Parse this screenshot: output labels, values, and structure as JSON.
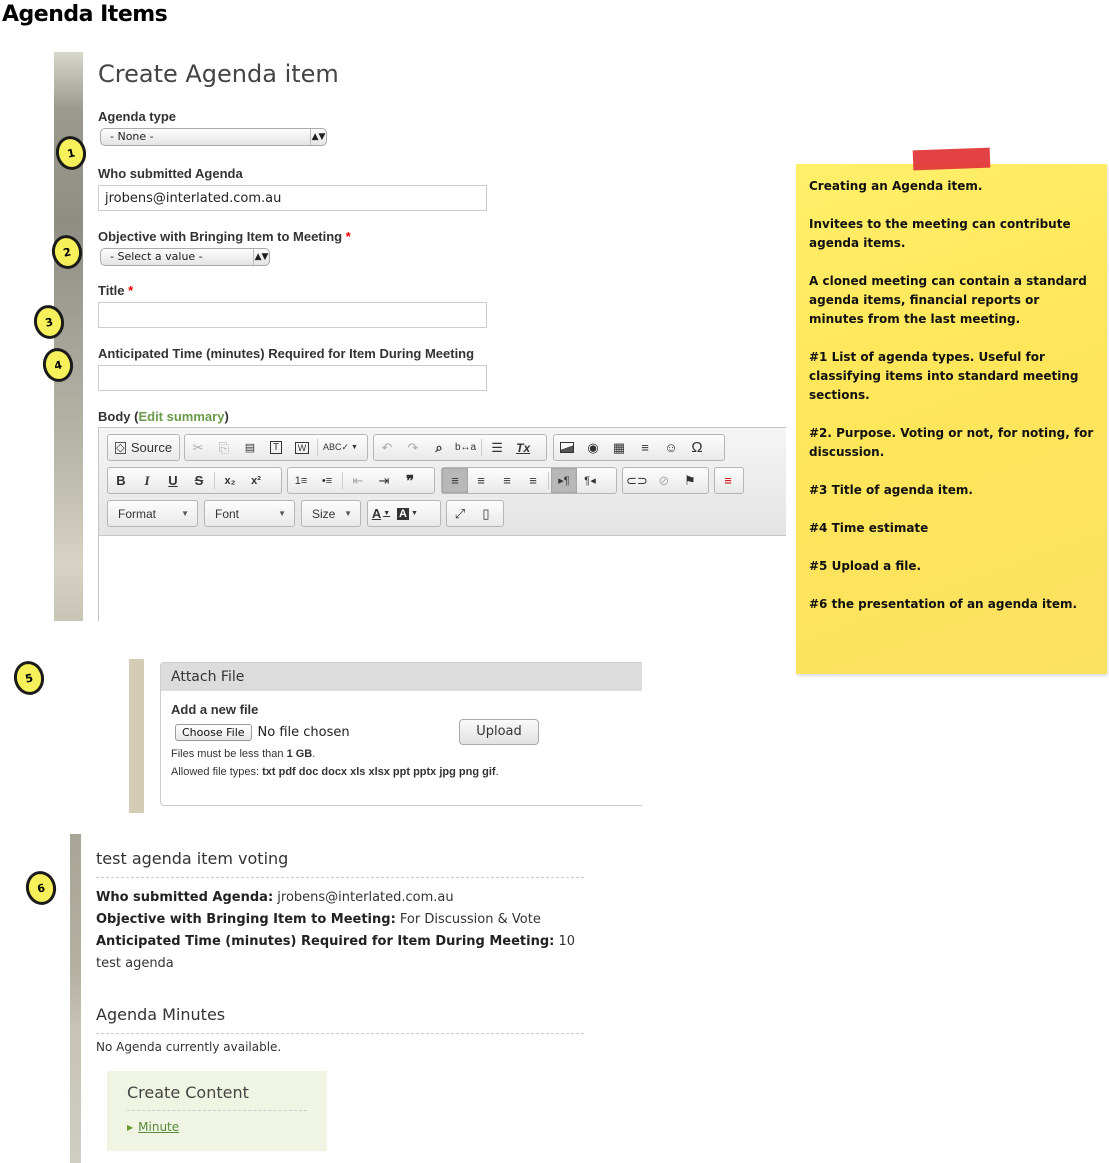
{
  "page": {
    "heading": "Agenda Items"
  },
  "markers": [
    "1",
    "2",
    "3",
    "4",
    "5",
    "6"
  ],
  "form": {
    "title": "Create Agenda item",
    "agenda_type": {
      "label": "Agenda type",
      "selected": "- None -"
    },
    "submitted_by": {
      "label": "Who submitted Agenda",
      "value": "jrobens@interlated.com.au"
    },
    "objective": {
      "label": "Objective with Bringing Item to Meeting",
      "required_mark": "*",
      "selected": "- Select a value -"
    },
    "title_field": {
      "label": "Title",
      "required_mark": "*",
      "value": ""
    },
    "time_field": {
      "label": "Anticipated Time (minutes) Required for Item During Meeting",
      "value": ""
    },
    "body": {
      "label": "Body",
      "open_paren": " (",
      "edit_summary_link": "Edit summary",
      "close_paren": ")"
    }
  },
  "editor": {
    "source_label": "Source",
    "format_label": "Format",
    "font_label": "Font",
    "size_label": "Size",
    "icons": {
      "source": "⧈",
      "cut": "✂",
      "copy": "⎘",
      "paste": "📋",
      "paste_text": "T",
      "paste_word": "W",
      "spellcheck": "ABC✓",
      "undo": "↶",
      "redo": "↷",
      "find": "🔍",
      "replace": "b↔a",
      "select_all": "☰",
      "remove_format": "Tx",
      "image": "🖼",
      "flash": "◉",
      "table": "▦",
      "hr": "≡",
      "smiley": "☺",
      "special_char": "Ω",
      "bold": "B",
      "italic": "I",
      "underline": "U",
      "strike": "S",
      "subscript": "x₂",
      "superscript": "x²",
      "numbered_list": "⒈",
      "bulleted_list": "•≡",
      "outdent": "⇤",
      "indent": "⇥",
      "blockquote": "❞",
      "align_left": "≡",
      "align_center": "≡",
      "align_right": "≡",
      "justify": "≡",
      "ltr": "▸¶",
      "rtl": "¶◂",
      "link": "⊖",
      "unlink": "⊘",
      "anchor": "⚑",
      "page_break": "≡",
      "text_color": "A",
      "bg_color": "A",
      "maximize": "⤢",
      "show_blocks": "▯"
    }
  },
  "note": {
    "paragraphs": [
      "Creating an Agenda item.",
      "Invitees to the meeting can contribute agenda items.",
      "A cloned meeting can contain a standard agenda items, financial reports  or minutes from the last meeting.",
      "#1 List of agenda types. Useful for classifying items into standard meeting sections.",
      "#2. Purpose. Voting or not, for noting, for discussion.",
      "#3 Title of agenda item.",
      "#4 Time estimate",
      "#5 Upload a file.",
      "#6 the presentation of an agenda item."
    ]
  },
  "attach": {
    "header": "Attach File",
    "add_label": "Add a new file",
    "choose_button": "Choose File",
    "no_file": "No file chosen",
    "upload_button": "Upload",
    "size_prefix": "Files must be less than ",
    "size_value": "1 GB",
    "size_suffix": ".",
    "types_prefix": "Allowed file types: ",
    "types_value": "txt pdf doc docx xls xlsx ppt pptx jpg png gif",
    "types_suffix": "."
  },
  "presentation": {
    "title": "test agenda item voting",
    "fields": [
      {
        "label": "Who submitted Agenda:",
        "value": " jrobens@interlated.com.au"
      },
      {
        "label": "Objective with Bringing Item to Meeting:",
        "value": " For Discussion & Vote"
      },
      {
        "label": "Anticipated Time (minutes) Required for Item During Meeting:",
        "value": " 10"
      }
    ],
    "body": "test agenda",
    "minutes_title": "Agenda Minutes",
    "minutes_empty": "No Agenda currently available.",
    "create_content": {
      "title": "Create Content",
      "links": [
        "Minute"
      ]
    }
  }
}
